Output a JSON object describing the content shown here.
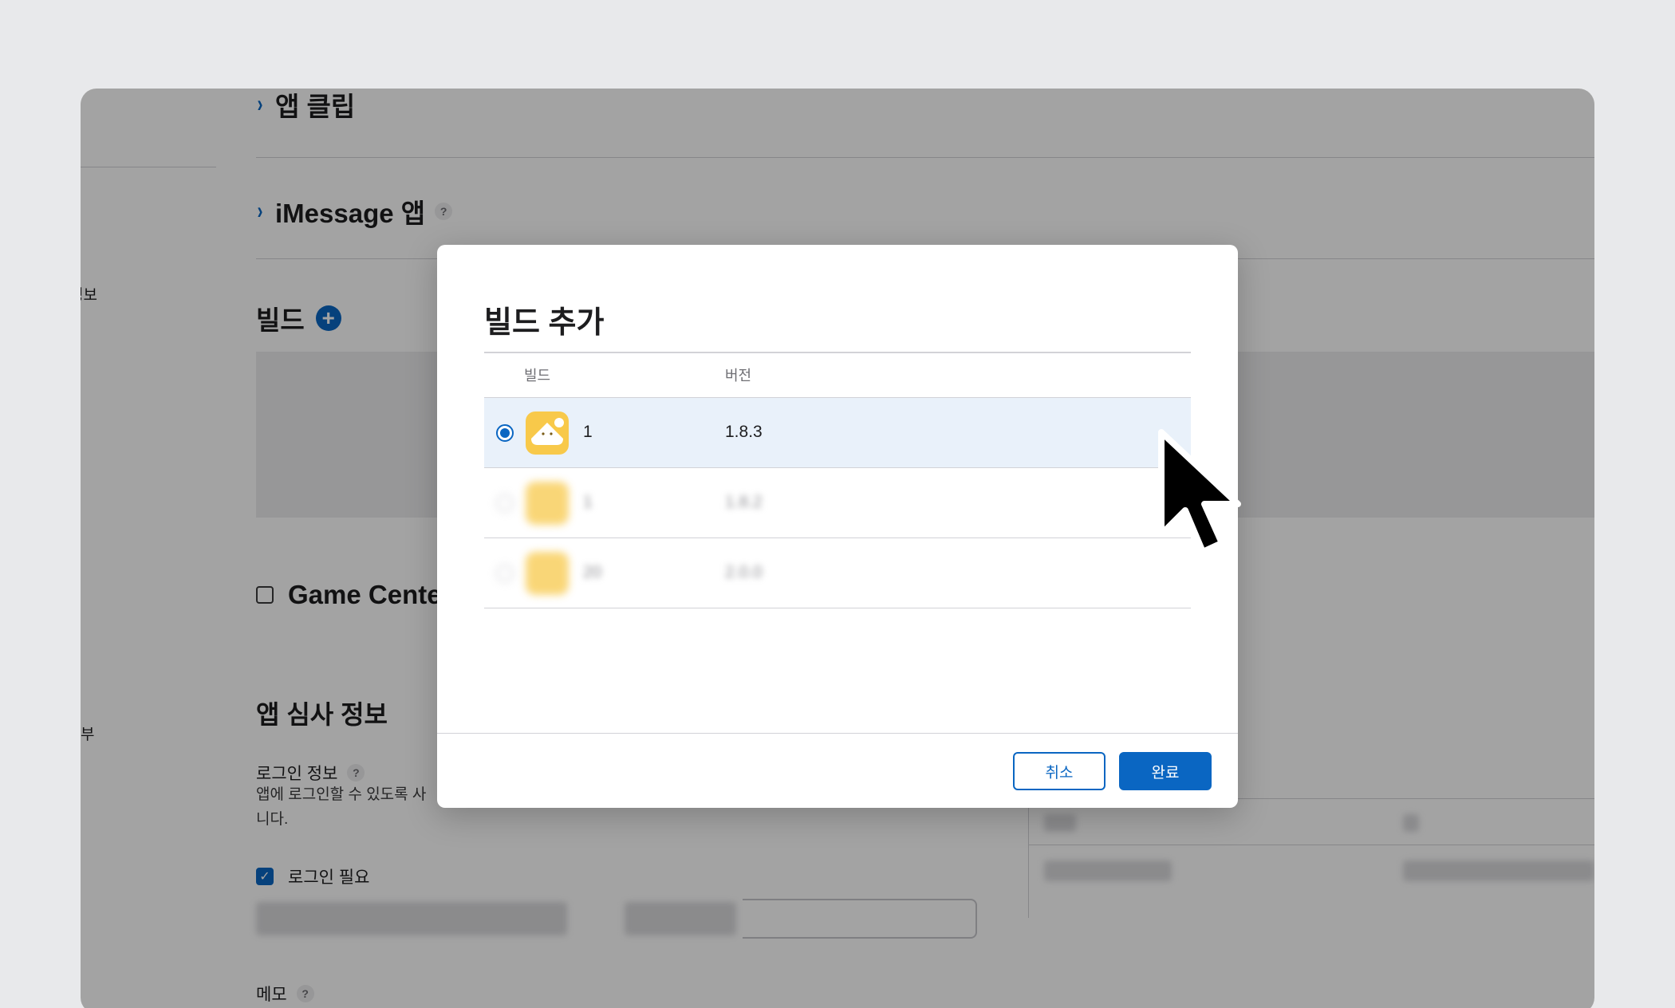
{
  "sections": {
    "app_clips": "앱 클립",
    "imessage_app": "iMessage 앱",
    "build": "빌드",
    "game_center": "Game Cente",
    "app_review_info": "앱 심사 정보"
  },
  "sidebar": {
    "fragment_1": "정보",
    "fragment_2": "부"
  },
  "review": {
    "login_info_label": "로그인 정보",
    "login_desc_line1": "앱에 로그인할 수 있도록 사",
    "login_desc_line2": "니다.",
    "login_required_label": "로그인 필요",
    "memo_label": "메모",
    "help": "?"
  },
  "modal": {
    "title": "빌드 추가",
    "col_build": "빌드",
    "col_version": "버전",
    "rows": [
      {
        "build": "1",
        "version": "1.8.3",
        "selected": true
      },
      {
        "build": "1",
        "version": "1.8.2",
        "selected": false,
        "blurred": true
      },
      {
        "build": "20",
        "version": "2.0.0",
        "selected": false,
        "blurred": true
      }
    ],
    "cancel_label": "취소",
    "done_label": "완료"
  },
  "colors": {
    "accent": "#0a66c2",
    "app_icon": "#f8c94a",
    "selected_row": "#e9f1fa",
    "overlay": "rgba(0,0,0,0.36)"
  },
  "icons": [
    "chevron-right-icon",
    "help-icon",
    "plus-circle-icon",
    "checkbox-icon",
    "radio-icon",
    "app-icon",
    "mouse-cursor-icon"
  ]
}
